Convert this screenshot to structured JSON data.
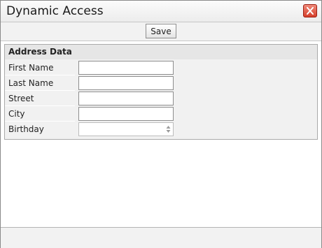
{
  "window": {
    "title": "Dynamic Access"
  },
  "toolbar": {
    "save_label": "Save"
  },
  "group": {
    "title": "Address Data",
    "fields": [
      {
        "label": "First Name",
        "value": ""
      },
      {
        "label": "Last Name",
        "value": ""
      },
      {
        "label": "Street",
        "value": ""
      },
      {
        "label": "City",
        "value": ""
      },
      {
        "label": "Birthday",
        "value": ""
      }
    ]
  },
  "icons": {
    "close": "close-icon",
    "spinner": "spinner-arrows-icon"
  },
  "colors": {
    "close_button": "#d6402c",
    "panel_background": "#f1f1f1"
  }
}
